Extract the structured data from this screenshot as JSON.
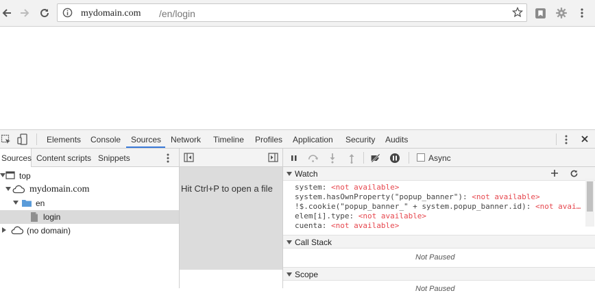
{
  "browser": {
    "url_host": "mydomain.com",
    "url_path": "/en/login",
    "icons": [
      "back-icon",
      "forward-icon",
      "reload-icon",
      "info-icon",
      "star-icon",
      "extension-icon",
      "puzzle-gear-icon",
      "menu-icon"
    ]
  },
  "devtools": {
    "tabs": [
      "Elements",
      "Console",
      "Sources",
      "Network",
      "Timeline",
      "Profiles",
      "Application",
      "Security",
      "Audits"
    ],
    "active_tab": "Sources",
    "navigator": {
      "tabs": [
        "Sources",
        "Content scripts",
        "Snippets"
      ],
      "tree": [
        {
          "label": "top",
          "level": 0,
          "icon": "frame-icon",
          "expanded": true
        },
        {
          "label": "mydomain.com",
          "level": 1,
          "icon": "cloud-icon",
          "expanded": true
        },
        {
          "label": "en",
          "level": 2,
          "icon": "folder-icon",
          "expanded": true
        },
        {
          "label": "login",
          "level": 3,
          "icon": "file-icon",
          "selected": true
        },
        {
          "label": "(no domain)",
          "level": 0,
          "icon": "cloud-icon",
          "expanded": false
        }
      ]
    },
    "editor": {
      "hint": "Hit Ctrl+P to open a file"
    },
    "debugger": {
      "async_label": "Async",
      "watch": {
        "title": "Watch",
        "expressions": [
          {
            "expr": "system: ",
            "value": "<not available>"
          },
          {
            "expr": "system.hasOwnProperty(\"popup_banner\"): ",
            "value": "<not available>"
          },
          {
            "expr": "!$.cookie(\"popup_banner_\" + system.popup_banner.id): ",
            "value": "<not avai…"
          },
          {
            "expr": "elem[i].type: ",
            "value": "<not available>"
          },
          {
            "expr": "cuenta: ",
            "value": "<not available>"
          }
        ]
      },
      "call_stack": {
        "title": "Call Stack",
        "status": "Not Paused"
      },
      "scope": {
        "title": "Scope",
        "status": "Not Paused"
      }
    }
  },
  "colors": {
    "accent": "#3879d9",
    "not_available": "#e6474e"
  }
}
